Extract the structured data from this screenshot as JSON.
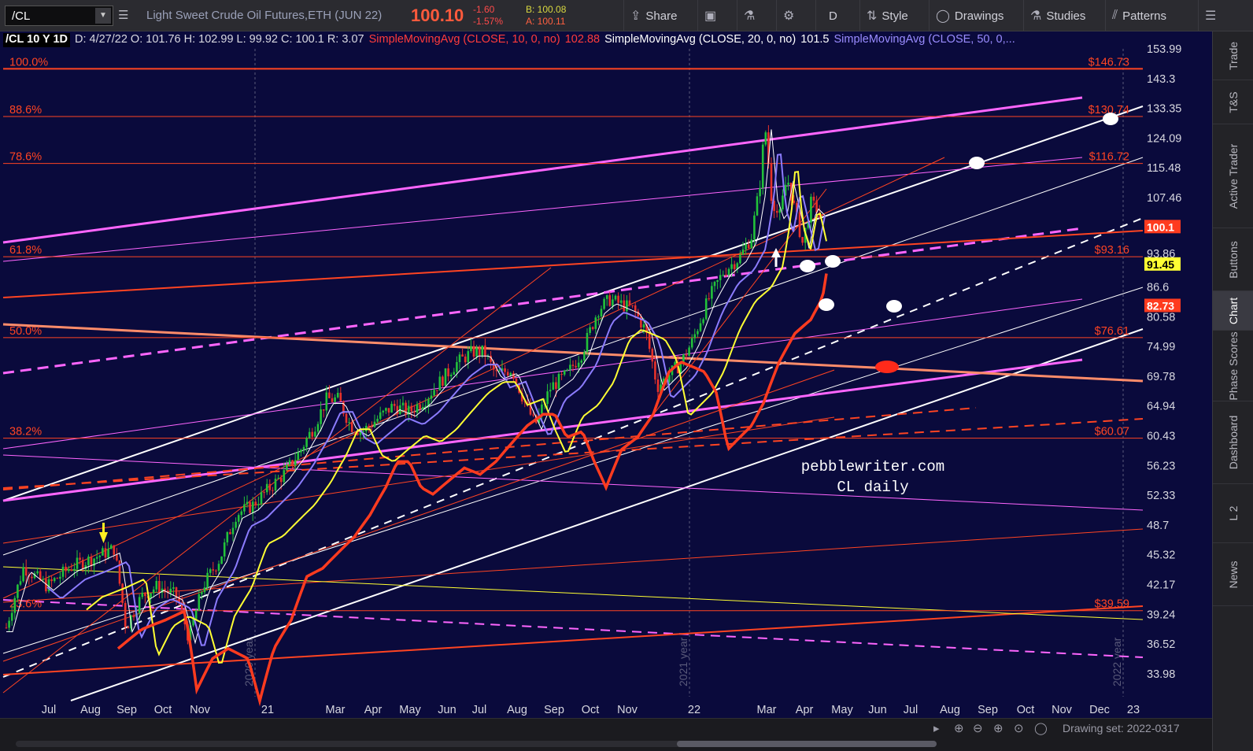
{
  "toolbar": {
    "symbol": "/CL",
    "description": "Light Sweet Crude Oil Futures,ETH (JUN 22)",
    "last": "100.10",
    "change": "-1.60",
    "change_pct": "-1.57%",
    "bid": "B: 100.08",
    "ask": "A: 100.11",
    "share": "Share",
    "period": "D",
    "style": "Style",
    "drawings": "Drawings",
    "studies": "Studies",
    "patterns": "Patterns"
  },
  "legend": {
    "symbol": "/CL 10 Y 1D",
    "ohlc": "D: 4/27/22  O: 101.76  H: 102.99  L: 99.92  C: 100.1  R: 3.07",
    "ma10": "SimpleMovingAvg (CLOSE, 10, 0, no)",
    "ma10_val": "102.88",
    "ma20": "SimpleMovingAvg (CLOSE, 20, 0, no)",
    "ma20_val": "101.5",
    "ma50": "SimpleMovingAvg (CLOSE, 50, 0,..."
  },
  "price_axis": [
    "153.99",
    "143.3",
    "133.35",
    "124.09",
    "115.48",
    "107.46",
    "100.1",
    "93.86",
    "91.45",
    "86.6",
    "82.73",
    "80.58",
    "74.99",
    "69.78",
    "64.94",
    "60.43",
    "56.23",
    "52.33",
    "48.7",
    "45.32",
    "42.17",
    "39.24",
    "36.52",
    "33.98"
  ],
  "price_badges": [
    {
      "label": "100.1",
      "bg": "#ff3b1f",
      "color": "#ffffff"
    },
    {
      "label": "91.45",
      "bg": "#ffff33",
      "color": "#000000"
    },
    {
      "label": "82.73",
      "bg": "#ff3b1f",
      "color": "#ffffff"
    }
  ],
  "time_axis": [
    "Jul",
    "Aug",
    "Sep",
    "Oct",
    "Nov",
    "21",
    "Mar",
    "Apr",
    "May",
    "Jun",
    "Jul",
    "Aug",
    "Sep",
    "Oct",
    "Nov",
    "22",
    "Mar",
    "Apr",
    "May",
    "Jun",
    "Jul",
    "Aug",
    "Sep",
    "Oct",
    "Nov",
    "Dec",
    "23"
  ],
  "year_markers": [
    "2020 year",
    "2021 year",
    "2022 year"
  ],
  "fib_levels": [
    {
      "pct": "100.0%",
      "price": "$146.73"
    },
    {
      "pct": "88.6%",
      "price": "$130.74"
    },
    {
      "pct": "78.6%",
      "price": "$116.72"
    },
    {
      "pct": "61.8%",
      "price": "$93.16"
    },
    {
      "pct": "50.0%",
      "price": "$76.61"
    },
    {
      "pct": "38.2%",
      "price": "$60.07"
    },
    {
      "pct": "23.6%",
      "price": "$39.59"
    }
  ],
  "watermark": [
    "pebblewriter.com",
    "CL daily"
  ],
  "bottom": {
    "drawing_set": "Drawing set: 2022-0317"
  },
  "sidepanel": [
    "Trade",
    "T&S",
    "Active Trader",
    "Buttons",
    "Chart",
    "Phase Scores",
    "Dashboard",
    "L 2",
    "News"
  ],
  "colors": {
    "background": "#0a0a3c",
    "fib": "#ff4422",
    "channel_white": "#ffffff",
    "channel_magenta": "#ff66ff",
    "ma10": "#ff3b3b",
    "ma20": "#ffffff",
    "ma50": "#8c7cff",
    "ma200_yellow": "#ffff33",
    "ma_orange": "#ff3b1f"
  }
}
